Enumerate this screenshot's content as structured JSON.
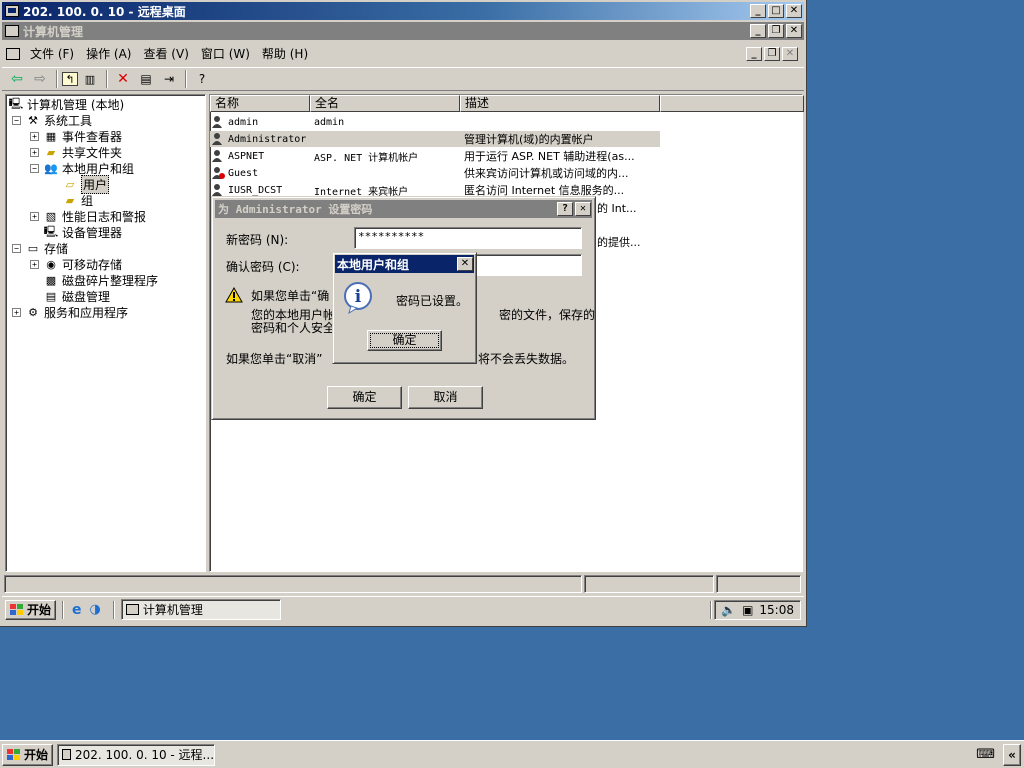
{
  "remote_window": {
    "title": "202. 100. 0. 10 - 远程桌面"
  },
  "mmc_window": {
    "title": "计算机管理"
  },
  "menu": [
    {
      "label": "文件 (F)"
    },
    {
      "label": "操作 (A)"
    },
    {
      "label": "查看 (V)"
    },
    {
      "label": "窗口 (W)"
    },
    {
      "label": "帮助 (H)"
    }
  ],
  "tree": {
    "root": "计算机管理 (本地)",
    "system_tools": "系统工具",
    "event_viewer": "事件查看器",
    "shared_folders": "共享文件夹",
    "local_users": "本地用户和组",
    "users": "用户",
    "groups": "组",
    "perf_logs": "性能日志和警报",
    "device_manager": "设备管理器",
    "storage": "存储",
    "removable": "可移动存储",
    "defrag": "磁盘碎片整理程序",
    "disk_mgmt": "磁盘管理",
    "services_apps": "服务和应用程序"
  },
  "list": {
    "columns": [
      "名称",
      "全名",
      "描述"
    ],
    "rows": [
      {
        "name": "admin",
        "full": "admin",
        "desc": ""
      },
      {
        "name": "Administrator",
        "full": "",
        "desc": "管理计算机(域)的内置帐户"
      },
      {
        "name": "ASPNET",
        "full": "ASP. NET 计算机帐户",
        "desc": "用于运行 ASP. NET 辅助进程(as..."
      },
      {
        "name": "Guest",
        "full": "",
        "desc": "供来宾访问计算机或访问域的内..."
      },
      {
        "name": "IUSR_DCST",
        "full": "Internet 来宾帐户",
        "desc": "匿名访问 Internet 信息服务的..."
      }
    ],
    "partial_desc_1": "的 Int...",
    "partial_desc_2": "的提供..."
  },
  "pwd_dialog": {
    "title": "为 Administrator 设置密码",
    "new_password_label": "新密码 (N):",
    "new_password_value": "**********",
    "confirm_label": "确认密码 (C):",
    "confirm_value": "",
    "warning_line1": "如果您单击“确",
    "warning_line2": "您的本地用户帐",
    "warning_line2_tail": "密的文件，保存的",
    "warning_line3": "密码和个人安全",
    "cancel_note": "如果您单击“取消”",
    "cancel_note_tail": "将不会丢失数据。",
    "ok": "确定",
    "cancel": "取消"
  },
  "msg_box": {
    "title": "本地用户和组",
    "message": "密码已设置。",
    "ok": "确定"
  },
  "inner_taskbar": {
    "start": "开始",
    "task": "计算机管理",
    "clock": "15:08"
  },
  "outer_taskbar": {
    "start": "开始",
    "task": "202. 100. 0. 10 - 远程..."
  }
}
